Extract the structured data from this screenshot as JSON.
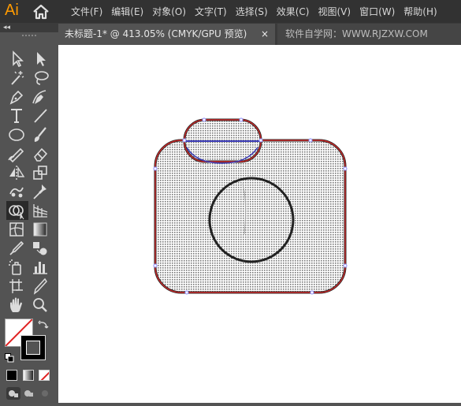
{
  "app": {
    "logo": "Ai"
  },
  "menu": [
    "文件(F)",
    "编辑(E)",
    "对象(O)",
    "文字(T)",
    "选择(S)",
    "效果(C)",
    "视图(V)",
    "窗口(W)",
    "帮助(H)"
  ],
  "tabs": [
    {
      "label": "未标题-1* @ 413.05% (CMYK/GPU 预览)",
      "close": "×"
    },
    {
      "label": "软件自学网：WWW.RJZXW.COM"
    }
  ],
  "toolbar": {
    "collapse": "◂◂"
  },
  "colors": {
    "menubar": "#323232",
    "panel": "#535353",
    "logo": "#ff9a00",
    "stroke_red": "#cc2a2a",
    "path_blue": "#3d3db8",
    "anchor": "#8a8aff"
  }
}
